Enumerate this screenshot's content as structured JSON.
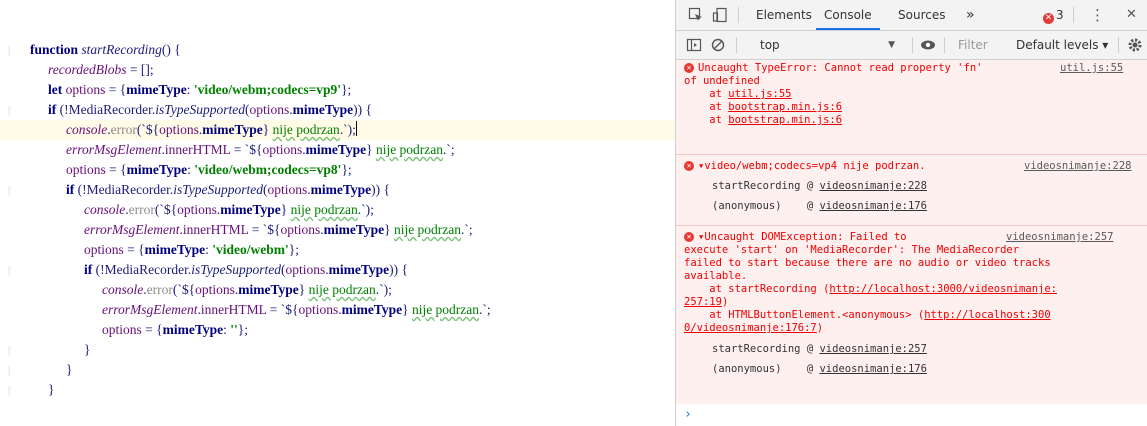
{
  "editor": {
    "lines": [
      {
        "gutter": "|",
        "segs": [
          {
            "c": "kw",
            "t": "function "
          },
          {
            "c": "fn-it",
            "t": "startRecording"
          },
          {
            "c": "plain",
            "t": "() {"
          }
        ]
      },
      {
        "gutter": "",
        "segs": [
          {
            "c": "va",
            "t": "recordedBlobs"
          },
          {
            "c": "plain",
            "t": " = [];"
          }
        ]
      },
      {
        "gutter": "",
        "segs": [
          {
            "c": "kw",
            "t": "let "
          },
          {
            "c": "va-n",
            "t": "options"
          },
          {
            "c": "plain",
            "t": " = {"
          },
          {
            "c": "kw",
            "t": "mimeType"
          },
          {
            "c": "plain",
            "t": ": "
          },
          {
            "c": "str",
            "t": "'video/webm;codecs=vp9'"
          },
          {
            "c": "plain",
            "t": "};"
          }
        ]
      },
      {
        "gutter": "|",
        "segs": [
          {
            "c": "kw",
            "t": "if "
          },
          {
            "c": "plain",
            "t": "(!MediaRecorder."
          },
          {
            "c": "fn-it",
            "t": "isTypeSupported"
          },
          {
            "c": "plain",
            "t": "("
          },
          {
            "c": "va-n",
            "t": "options"
          },
          {
            "c": "plain",
            "t": "."
          },
          {
            "c": "kw",
            "t": "mimeType"
          },
          {
            "c": "plain",
            "t": ")) {"
          }
        ]
      },
      {
        "gutter": "",
        "hl": true,
        "caret": true,
        "segs": [
          {
            "c": "va",
            "t": "console"
          },
          {
            "c": "plain",
            "t": "."
          },
          {
            "c": "err",
            "t": "error"
          },
          {
            "c": "plain",
            "t": "(`${"
          },
          {
            "c": "va-n",
            "t": "options"
          },
          {
            "c": "plain",
            "t": "."
          },
          {
            "c": "kw",
            "t": "mimeType"
          },
          {
            "c": "plain",
            "t": "} "
          },
          {
            "c": "tpl u",
            "t": "nije podrzan"
          },
          {
            "c": "plain",
            "t": ".`);"
          }
        ]
      },
      {
        "gutter": "",
        "segs": [
          {
            "c": "va",
            "t": "errorMsgElement"
          },
          {
            "c": "plain",
            "t": "."
          },
          {
            "c": "va-n",
            "t": "innerHTML"
          },
          {
            "c": "plain",
            "t": " = `${"
          },
          {
            "c": "va-n",
            "t": "options"
          },
          {
            "c": "plain",
            "t": "."
          },
          {
            "c": "kw",
            "t": "mimeType"
          },
          {
            "c": "plain",
            "t": "} "
          },
          {
            "c": "tpl u",
            "t": "nije podrzan"
          },
          {
            "c": "plain",
            "t": ".`;"
          }
        ]
      },
      {
        "gutter": "",
        "segs": [
          {
            "c": "va-n",
            "t": "options"
          },
          {
            "c": "plain",
            "t": " = {"
          },
          {
            "c": "kw",
            "t": "mimeType"
          },
          {
            "c": "plain",
            "t": ": "
          },
          {
            "c": "str",
            "t": "'video/webm;codecs=vp8'"
          },
          {
            "c": "plain",
            "t": "};"
          }
        ]
      },
      {
        "gutter": "|",
        "segs": [
          {
            "c": "kw",
            "t": "if "
          },
          {
            "c": "plain",
            "t": "(!MediaRecorder."
          },
          {
            "c": "fn-it",
            "t": "isTypeSupported"
          },
          {
            "c": "plain",
            "t": "("
          },
          {
            "c": "va-n",
            "t": "options"
          },
          {
            "c": "plain",
            "t": "."
          },
          {
            "c": "kw",
            "t": "mimeType"
          },
          {
            "c": "plain",
            "t": ")) {"
          }
        ]
      },
      {
        "gutter": "",
        "segs": [
          {
            "c": "va",
            "t": "console"
          },
          {
            "c": "plain",
            "t": "."
          },
          {
            "c": "err",
            "t": "error"
          },
          {
            "c": "plain",
            "t": "(`${"
          },
          {
            "c": "va-n",
            "t": "options"
          },
          {
            "c": "plain",
            "t": "."
          },
          {
            "c": "kw",
            "t": "mimeType"
          },
          {
            "c": "plain",
            "t": "} "
          },
          {
            "c": "tpl u",
            "t": "nije podrzan"
          },
          {
            "c": "plain",
            "t": ".`);"
          }
        ]
      },
      {
        "gutter": "",
        "segs": [
          {
            "c": "va",
            "t": "errorMsgElement"
          },
          {
            "c": "plain",
            "t": "."
          },
          {
            "c": "va-n",
            "t": "innerHTML"
          },
          {
            "c": "plain",
            "t": " = `${"
          },
          {
            "c": "va-n",
            "t": "options"
          },
          {
            "c": "plain",
            "t": "."
          },
          {
            "c": "kw",
            "t": "mimeType"
          },
          {
            "c": "plain",
            "t": "} "
          },
          {
            "c": "tpl u",
            "t": "nije podrzan"
          },
          {
            "c": "plain",
            "t": ".`;"
          }
        ]
      },
      {
        "gutter": "",
        "segs": [
          {
            "c": "va-n",
            "t": "options"
          },
          {
            "c": "plain",
            "t": " = {"
          },
          {
            "c": "kw",
            "t": "mimeType"
          },
          {
            "c": "plain",
            "t": ": "
          },
          {
            "c": "str",
            "t": "'video/webm'"
          },
          {
            "c": "plain",
            "t": "};"
          }
        ]
      },
      {
        "gutter": "|",
        "segs": [
          {
            "c": "kw",
            "t": "if "
          },
          {
            "c": "plain",
            "t": "(!MediaRecorder."
          },
          {
            "c": "fn-it",
            "t": "isTypeSupported"
          },
          {
            "c": "plain",
            "t": "("
          },
          {
            "c": "va-n",
            "t": "options"
          },
          {
            "c": "plain",
            "t": "."
          },
          {
            "c": "kw",
            "t": "mimeType"
          },
          {
            "c": "plain",
            "t": ")) {"
          }
        ]
      },
      {
        "gutter": "",
        "segs": [
          {
            "c": "va",
            "t": "console"
          },
          {
            "c": "plain",
            "t": "."
          },
          {
            "c": "err",
            "t": "error"
          },
          {
            "c": "plain",
            "t": "(`${"
          },
          {
            "c": "va-n",
            "t": "options"
          },
          {
            "c": "plain",
            "t": "."
          },
          {
            "c": "kw",
            "t": "mimeType"
          },
          {
            "c": "plain",
            "t": "} "
          },
          {
            "c": "tpl u",
            "t": "nije podrzan"
          },
          {
            "c": "plain",
            "t": ".`);"
          }
        ]
      },
      {
        "gutter": "",
        "segs": [
          {
            "c": "va",
            "t": "errorMsgElement"
          },
          {
            "c": "plain",
            "t": "."
          },
          {
            "c": "va-n",
            "t": "innerHTML"
          },
          {
            "c": "plain",
            "t": " = `${"
          },
          {
            "c": "va-n",
            "t": "options"
          },
          {
            "c": "plain",
            "t": "."
          },
          {
            "c": "kw",
            "t": "mimeType"
          },
          {
            "c": "plain",
            "t": "} "
          },
          {
            "c": "tpl u",
            "t": "nije podrzan"
          },
          {
            "c": "plain",
            "t": ".`;"
          }
        ]
      },
      {
        "gutter": "",
        "segs": [
          {
            "c": "va-n",
            "t": "options"
          },
          {
            "c": "plain",
            "t": " = {"
          },
          {
            "c": "kw",
            "t": "mimeType"
          },
          {
            "c": "plain",
            "t": ": "
          },
          {
            "c": "str",
            "t": "''"
          },
          {
            "c": "plain",
            "t": "};"
          }
        ]
      },
      {
        "gutter": "|",
        "segs": [
          {
            "c": "plain",
            "t": "}"
          }
        ]
      },
      {
        "gutter": "|",
        "segs": [
          {
            "c": "plain",
            "t": "}"
          }
        ]
      },
      {
        "gutter": "|",
        "segs": [
          {
            "c": "plain",
            "t": "}"
          }
        ]
      }
    ]
  },
  "devtools": {
    "tabs": {
      "elements": "Elements",
      "console": "Console",
      "sources": "Sources",
      "more": "»"
    },
    "error_count": "3",
    "kebab": "⋮",
    "close": "✕",
    "toolbar": {
      "context": "top",
      "filter_placeholder": "Filter",
      "levels": "Default levels ▾"
    },
    "messages": [
      {
        "source": "util.js:55",
        "lines": [
          "Uncaught TypeError: Cannot read property 'fn'",
          "of undefined"
        ],
        "stack": [
          {
            "pre": "    at ",
            "link": "util.js:55"
          },
          {
            "pre": "    at ",
            "link": "bootstrap.min.js:6"
          },
          {
            "pre": "    at ",
            "link": "bootstrap.min.js:6"
          }
        ]
      },
      {
        "source": "videosnimanje:228",
        "lines": [
          "▾video/webm;codecs=vp4 nije podrzan."
        ],
        "calls": [
          {
            "fn": "startRecording",
            "at": " @ ",
            "link": "videosnimanje:228"
          },
          {
            "fn": "(anonymous)",
            "at": "    @ ",
            "link": "videosnimanje:176"
          }
        ]
      },
      {
        "source": "videosnimanje:257",
        "lines": [
          "▾Uncaught DOMException: Failed to",
          "execute 'start' on 'MediaRecorder': The MediaRecorder",
          "failed to start because there are no audio or video tracks",
          "available."
        ],
        "stack": [
          {
            "pre": "    at startRecording (",
            "link": "http://localhost:3000/videosnimanje:",
            "post": ""
          },
          {
            "pre": "",
            "link": "257:19",
            "post": ")"
          },
          {
            "pre": "    at HTMLButtonElement.<anonymous> (",
            "link": "http://localhost:300",
            "post": ""
          },
          {
            "pre": "",
            "link": "0/videosnimanje:176:7",
            "post": ")"
          }
        ],
        "calls": [
          {
            "fn": "startRecording",
            "at": " @ ",
            "link": "videosnimanje:257"
          },
          {
            "fn": "(anonymous)",
            "at": "    @ ",
            "link": "videosnimanje:176"
          }
        ]
      }
    ],
    "prompt": "›"
  },
  "colors": {
    "error_red": "#e00000",
    "error_bg": "#fff0f0",
    "accent": "#1a73e8"
  }
}
